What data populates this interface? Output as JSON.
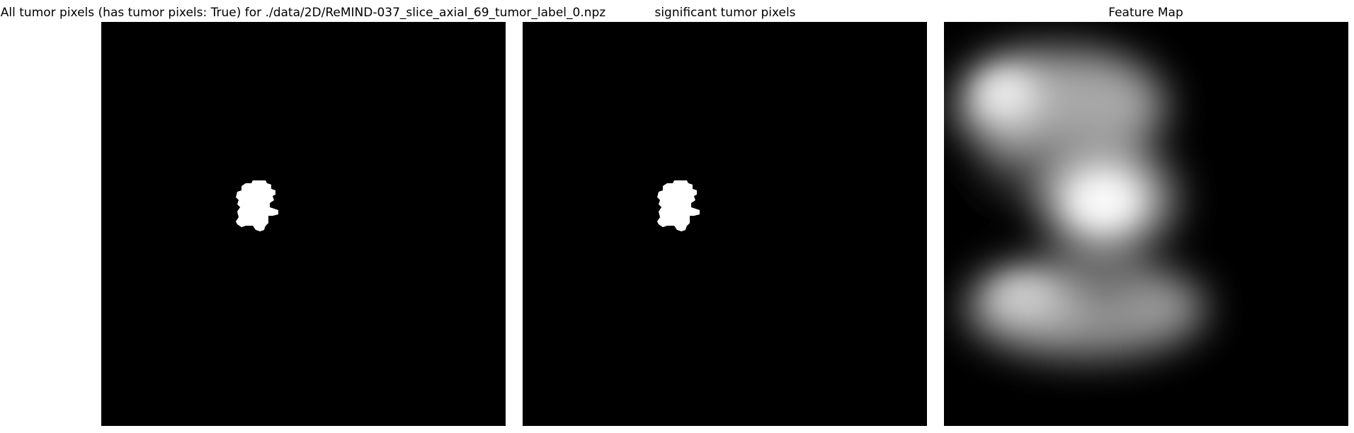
{
  "figure": {
    "panels": [
      {
        "title": "All tumor pixels (has tumor pixels: True) for ./data/2D/ReMIND-037_slice_axial_69_tumor_label_0.npz",
        "kind": "mask",
        "cmap": "gray"
      },
      {
        "title": "significant tumor pixels",
        "kind": "mask",
        "cmap": "gray"
      },
      {
        "title": "Feature Map",
        "kind": "heatmap",
        "cmap": "gray"
      }
    ],
    "colors": {
      "background": "#000000",
      "foreground": "#ffffff",
      "page": "#ffffff"
    }
  }
}
